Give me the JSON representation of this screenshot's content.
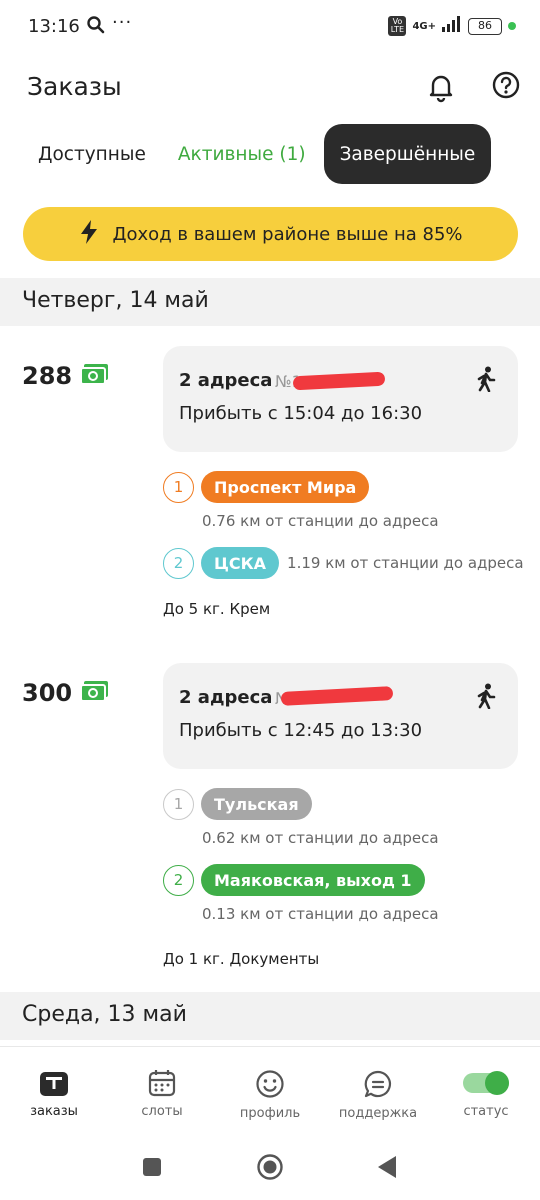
{
  "status_bar": {
    "time": "13:16",
    "dots": "···",
    "volte": "Vo LTE",
    "network": "4G+",
    "battery": "86"
  },
  "header": {
    "title": "Заказы"
  },
  "tabs": [
    {
      "label": "Доступные"
    },
    {
      "label": "Активные (1)"
    },
    {
      "label": "Завершённые"
    }
  ],
  "banner": {
    "text": "Доход в вашем районе выше на 85%"
  },
  "days": [
    {
      "label": "Четверг, 14 май"
    },
    {
      "label": "Среда, 13 май"
    }
  ],
  "orders": [
    {
      "price": "288",
      "addresses": "2 адреса",
      "number": "№1",
      "arrive": "Прибыть с 15:04 до 16:30",
      "stops": [
        {
          "n": "1",
          "name": "Проспект Мира",
          "color": "#f07c22",
          "dist": "0.76 км от станции до адреса"
        },
        {
          "n": "2",
          "name": "ЦСКА",
          "color": "#5fc8cf",
          "dist": "1.19 км от станции до адреса"
        }
      ],
      "cargo": "До 5 кг. Крем"
    },
    {
      "price": "300",
      "addresses": "2 адреса",
      "number": "№",
      "arrive": "Прибыть с 12:45 до 13:30",
      "stops": [
        {
          "n": "1",
          "name": "Тульская",
          "color": "#a7a7a7",
          "dist": "0.62 км от станции до адреса"
        },
        {
          "n": "2",
          "name": "Маяковская, выход 1",
          "color": "#3fae48",
          "dist": "0.13 км от станции до адреса"
        }
      ],
      "cargo": "До 1 кг. Документы"
    }
  ],
  "bottom_nav": [
    {
      "label": "заказы",
      "icon": "orders-icon"
    },
    {
      "label": "слоты",
      "icon": "calendar-icon"
    },
    {
      "label": "профиль",
      "icon": "smiley-icon"
    },
    {
      "label": "поддержка",
      "icon": "chat-icon"
    },
    {
      "label": "статус",
      "icon": "toggle-icon"
    }
  ],
  "colors": {
    "accent_green": "#3faa3f",
    "banner_yellow": "#f7cf3d",
    "money_green": "#3cb44b",
    "redact_red": "#f0393e"
  }
}
